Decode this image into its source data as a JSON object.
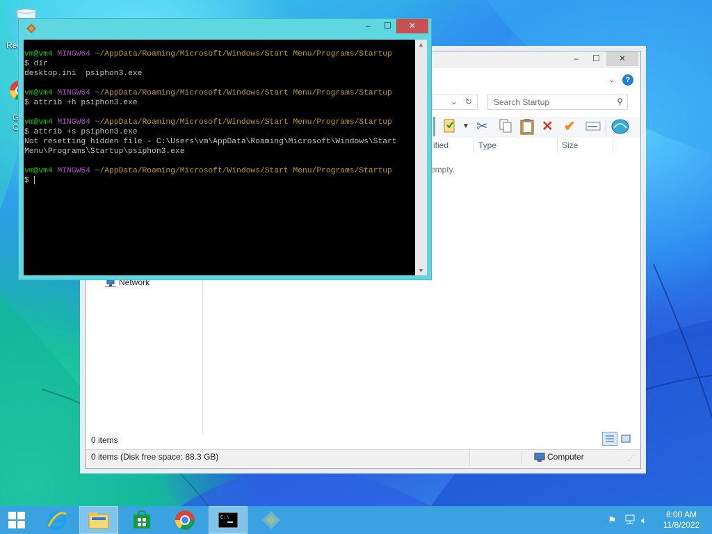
{
  "desktop": {
    "icons": [
      {
        "name": "recycle-bin",
        "label": "Rec"
      },
      {
        "name": "google-chrome",
        "label": "G\nC"
      }
    ]
  },
  "explorer": {
    "search_placeholder": "Search Startup",
    "columns": [
      "ified",
      "Type",
      "Size"
    ],
    "empty_text": "empty.",
    "nav_network": "Network",
    "items_count": "0 items",
    "status_detail": "0 items (Disk free space: 88.3 GB)",
    "status_location": "Computer",
    "title_buttons": {
      "minimize": "–",
      "maximize": "☐",
      "close": "✕"
    }
  },
  "terminal": {
    "title_buttons": {
      "minimize": "–",
      "maximize": "☐",
      "close": "✕"
    },
    "lines": [
      {
        "type": "prompt",
        "user": "vm@vm4",
        "host": "MINGW64",
        "path": "~/AppData/Roaming/Microsoft/Windows/Start Menu/Programs/Startup"
      },
      {
        "type": "cmd",
        "text": "$ dir"
      },
      {
        "type": "out",
        "text": "desktop.ini  psiphon3.exe"
      },
      {
        "type": "blank",
        "text": ""
      },
      {
        "type": "prompt",
        "user": "vm@vm4",
        "host": "MINGW64",
        "path": "~/AppData/Roaming/Microsoft/Windows/Start Menu/Programs/Startup"
      },
      {
        "type": "cmd",
        "text": "$ attrib +h psiphon3.exe"
      },
      {
        "type": "blank",
        "text": ""
      },
      {
        "type": "prompt",
        "user": "vm@vm4",
        "host": "MINGW64",
        "path": "~/AppData/Roaming/Microsoft/Windows/Start Menu/Programs/Startup"
      },
      {
        "type": "cmd",
        "text": "$ attrib +s psiphon3.exe"
      },
      {
        "type": "out",
        "text": "Not resetting hidden file - C:\\Users\\vm\\AppData\\Roaming\\Microsoft\\Windows\\Start"
      },
      {
        "type": "out",
        "text": "Menu\\Programs\\Startup\\psiphon3.exe"
      },
      {
        "type": "blank",
        "text": ""
      },
      {
        "type": "prompt",
        "user": "vm@vm4",
        "host": "MINGW64",
        "path": "~/AppData/Roaming/Microsoft/Windows/Start Menu/Programs/Startup"
      },
      {
        "type": "input",
        "text": "$ "
      }
    ]
  },
  "taskbar": {
    "buttons": [
      "start-button",
      "internet-explorer",
      "file-explorer",
      "windows-store",
      "google-chrome",
      "command-prompt",
      "git-bash"
    ],
    "clock_time": "8:00 AM",
    "clock_date": "11/8/2022"
  },
  "colors": {
    "terminal_frame": "#5fd7e0",
    "taskbar": "#3aa2e0",
    "prompt_user": "#16c60c",
    "prompt_host": "#b148c6",
    "prompt_path": "#c19c00"
  }
}
